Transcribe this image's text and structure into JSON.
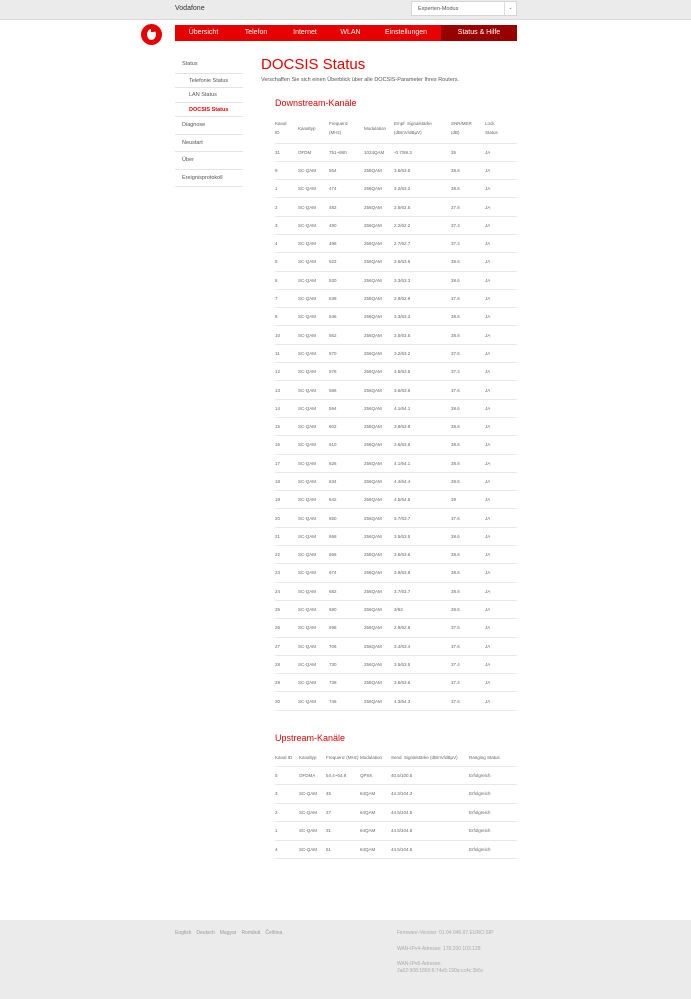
{
  "header": {
    "brand": "Vodafone",
    "mode_select": {
      "selected": "Experten-Modus"
    },
    "logo": "vodafone-logo",
    "nav": [
      {
        "label": "Übersicht",
        "active": false
      },
      {
        "label": "Telefon",
        "active": false
      },
      {
        "label": "Internet",
        "active": false
      },
      {
        "label": "WLAN",
        "active": false
      },
      {
        "label": "Einstellungen",
        "active": false
      },
      {
        "label": "Status & Hilfe",
        "active": true
      }
    ]
  },
  "sidebar": {
    "items": [
      {
        "label": "Status",
        "sub": false,
        "active": false
      },
      {
        "label": "Telefonie Status",
        "sub": true,
        "active": false
      },
      {
        "label": "LAN Status",
        "sub": true,
        "active": false
      },
      {
        "label": "DOCSIS Status",
        "sub": true,
        "active": true
      },
      {
        "label": "Diagnose",
        "sub": false,
        "active": false
      },
      {
        "label": "Neustart",
        "sub": false,
        "active": false
      },
      {
        "label": "Über",
        "sub": false,
        "active": false
      },
      {
        "label": "Ereignisprotokoll",
        "sub": false,
        "active": false
      }
    ]
  },
  "main": {
    "title": "DOCSIS Status",
    "subtitle": "Verschaffen Sie sich einen Überblick über alle DOCSIS-Parameter Ihres Routers.",
    "downstream": {
      "title": "Downstream-Kanäle",
      "headers": [
        [
          "Kanal",
          "ID"
        ],
        [
          "Kanaltyp",
          ""
        ],
        [
          "Frequenz",
          "(MHz)"
        ],
        [
          "Modulation",
          ""
        ],
        [
          "Empf. Signalstärke",
          "(dBmV/dBµV)"
        ],
        [
          "SNR/MER",
          "(dB)"
        ],
        [
          "Lock",
          "Status"
        ]
      ],
      "rows": [
        [
          "31",
          "OFDM",
          "751~860",
          "1024QAM",
          "-0.7/59.3",
          "35",
          "JA"
        ],
        [
          "9",
          "SC-QAM",
          "554",
          "256QAM",
          "3.5/63.5",
          "38.6",
          "JA"
        ],
        [
          "1",
          "SC-QAM",
          "474",
          "256QAM",
          "3.2/63.2",
          "38.6",
          "JA"
        ],
        [
          "2",
          "SC-QAM",
          "482",
          "256QAM",
          "2.5/62.5",
          "37.6",
          "JA"
        ],
        [
          "3",
          "SC-QAM",
          "490",
          "256QAM",
          "2.2/62.2",
          "37.4",
          "JA"
        ],
        [
          "4",
          "SC-QAM",
          "498",
          "256QAM",
          "2.7/62.7",
          "37.4",
          "JA"
        ],
        [
          "5",
          "SC-QAM",
          "522",
          "256QAM",
          "3.6/63.6",
          "38.6",
          "JA"
        ],
        [
          "6",
          "SC-QAM",
          "530",
          "256QAM",
          "3.3/63.3",
          "38.6",
          "JA"
        ],
        [
          "7",
          "SC-QAM",
          "538",
          "256QAM",
          "2.9/62.9",
          "37.6",
          "JA"
        ],
        [
          "8",
          "SC-QAM",
          "546",
          "256QAM",
          "3.3/63.3",
          "38.6",
          "JA"
        ],
        [
          "10",
          "SC-QAM",
          "562",
          "256QAM",
          "3.5/63.5",
          "38.6",
          "JA"
        ],
        [
          "11",
          "SC-QAM",
          "570",
          "256QAM",
          "3.2/63.2",
          "37.6",
          "JA"
        ],
        [
          "12",
          "SC-QAM",
          "578",
          "256QAM",
          "3.5/63.5",
          "37.4",
          "JA"
        ],
        [
          "13",
          "SC-QAM",
          "586",
          "256QAM",
          "3.6/63.6",
          "37.6",
          "JA"
        ],
        [
          "14",
          "SC-QAM",
          "594",
          "256QAM",
          "4.1/64.1",
          "38.6",
          "JA"
        ],
        [
          "15",
          "SC-QAM",
          "602",
          "256QAM",
          "3.8/63.8",
          "38.6",
          "JA"
        ],
        [
          "16",
          "SC-QAM",
          "610",
          "256QAM",
          "3.6/63.6",
          "38.6",
          "JA"
        ],
        [
          "17",
          "SC-QAM",
          "626",
          "256QAM",
          "4.1/64.1",
          "38.6",
          "JA"
        ],
        [
          "18",
          "SC-QAM",
          "634",
          "256QAM",
          "4.4/64.4",
          "38.6",
          "JA"
        ],
        [
          "19",
          "SC-QAM",
          "642",
          "256QAM",
          "4.5/64.5",
          "39",
          "JA"
        ],
        [
          "20",
          "SC-QAM",
          "650",
          "256QAM",
          "3.7/63.7",
          "37.6",
          "JA"
        ],
        [
          "21",
          "SC-QAM",
          "658",
          "256QAM",
          "3.5/63.5",
          "38.6",
          "JA"
        ],
        [
          "22",
          "SC-QAM",
          "666",
          "256QAM",
          "3.6/63.6",
          "38.6",
          "JA"
        ],
        [
          "23",
          "SC-QAM",
          "674",
          "256QAM",
          "3.9/63.9",
          "38.6",
          "JA"
        ],
        [
          "24",
          "SC-QAM",
          "682",
          "256QAM",
          "3.7/63.7",
          "38.6",
          "JA"
        ],
        [
          "25",
          "SC-QAM",
          "690",
          "256QAM",
          "3/63",
          "38.6",
          "JA"
        ],
        [
          "26",
          "SC-QAM",
          "698",
          "256QAM",
          "2.9/62.9",
          "37.6",
          "JA"
        ],
        [
          "27",
          "SC-QAM",
          "706",
          "256QAM",
          "3.4/63.4",
          "37.6",
          "JA"
        ],
        [
          "28",
          "SC-QAM",
          "730",
          "256QAM",
          "3.5/63.5",
          "37.4",
          "JA"
        ],
        [
          "29",
          "SC-QAM",
          "738",
          "256QAM",
          "3.6/63.6",
          "37.4",
          "JA"
        ],
        [
          "30",
          "SC-QAM",
          "746",
          "256QAM",
          "4.3/64.3",
          "37.6",
          "JA"
        ]
      ]
    },
    "upstream": {
      "title": "Upstream-Kanäle",
      "headers": [
        "Kanal ID",
        "Kanaltyp",
        "Frequenz (MHz)",
        "Modulation",
        "Send. Signalstärke (dBmV/dBµV)",
        "Ranging Status"
      ],
      "rows": [
        [
          "5",
          "OFDMA",
          "54.4~64.8",
          "QPSK",
          "40.5/100.5",
          "Erfolgreich"
        ],
        [
          "3",
          "SC-QAM",
          "45",
          "64QAM",
          "44.3/104.3",
          "Erfolgreich"
        ],
        [
          "2",
          "SC-QAM",
          "37",
          "64QAM",
          "44.5/104.5",
          "Erfolgreich"
        ],
        [
          "1",
          "SC-QAM",
          "31",
          "64QAM",
          "44.5/104.5",
          "Erfolgreich"
        ],
        [
          "4",
          "SC-QAM",
          "51",
          "64QAM",
          "44.5/104.5",
          "Erfolgreich"
        ]
      ]
    }
  },
  "footer": {
    "languages": [
      "English",
      "Deutsch",
      "Magyar",
      "Română",
      "Čeština"
    ],
    "firmware": "Firmware-Version: 01.04.046.07.EURO.SIP",
    "wan_ipv4": "WAN-IPv4-Adresse: 178.200.103.128",
    "wan_ipv6_label": "WAN-IPv6-Adresse:",
    "wan_ipv6": "2a02:908:1800:6:74e5:190a:cc4c:3b5c"
  },
  "colors": {
    "brand_red": "#e60000",
    "active_nav": "#990000"
  }
}
